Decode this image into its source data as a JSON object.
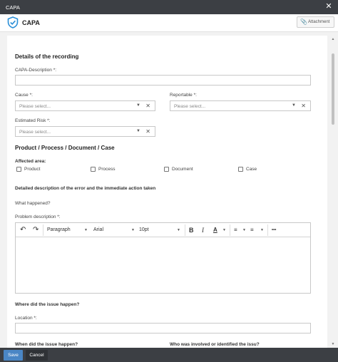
{
  "window": {
    "title": "CAPA",
    "close_glyph": "✕"
  },
  "header": {
    "app_name": "CAPA",
    "logo_icon": "shield-check-icon",
    "attachment_label": "Attachment",
    "attachment_icon": "paperclip-icon"
  },
  "form": {
    "section_details": "Details of the recording",
    "capa_description_label": "CAPA-Description *:",
    "cause_label": "Cause *:",
    "reportable_label": "Reportable *:",
    "estimated_risk_label": "Estimated Risk *:",
    "select_placeholder": "Please select...",
    "section_product": "Product / Process / Document / Case",
    "affected_area_label": "Affected area:",
    "affected_options": [
      "Product",
      "Process",
      "Document",
      "Case"
    ],
    "detailed_description_title": "Detailed description of the error and the immediate action taken",
    "what_happened_label": "What happened?",
    "problem_description_label": "Problem description *:",
    "where_title": "Where did the issue happen?",
    "location_label": "Location *:",
    "when_title": "When did the issue happen?",
    "who_title": "Who was involved or identified the issu?"
  },
  "editor_toolbar": {
    "paragraph": "Paragraph",
    "font": "Arial",
    "size": "10pt",
    "bold": "B",
    "italic": "I",
    "text_color": "A",
    "more": "•••"
  },
  "footer": {
    "save_label": "Save",
    "cancel_label": "Cancel"
  },
  "colors": {
    "titlebar": "#3c3f44",
    "accent": "#4a86c5",
    "logo": "#2a8fd8"
  }
}
